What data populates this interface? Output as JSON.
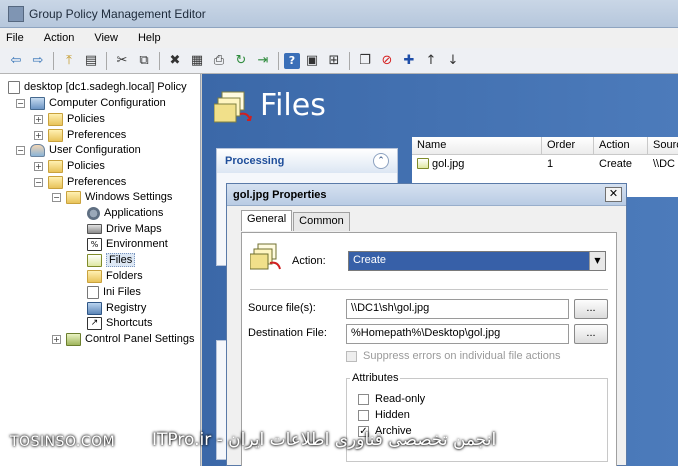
{
  "window": {
    "title": "Group Policy Management Editor"
  },
  "menu": [
    "File",
    "Action",
    "View",
    "Help"
  ],
  "toolbar": {
    "buttons": [
      {
        "name": "back-icon",
        "glyph": "⇦"
      },
      {
        "name": "forward-icon",
        "glyph": "⇨"
      },
      {
        "name": "up-folder-icon",
        "glyph": "⤒"
      },
      {
        "name": "show-hide-tree-icon",
        "glyph": "▤"
      },
      {
        "name": "cut-icon",
        "glyph": "✂"
      },
      {
        "name": "copy-icon",
        "glyph": "⧉"
      },
      {
        "name": "delete-icon",
        "glyph": "✖"
      },
      {
        "name": "properties-icon",
        "glyph": "▦"
      },
      {
        "name": "print-icon",
        "glyph": "⎙"
      },
      {
        "name": "refresh-icon",
        "glyph": "↻"
      },
      {
        "name": "export-icon",
        "glyph": "⇥"
      },
      {
        "name": "help-icon",
        "glyph": "?"
      },
      {
        "name": "view-icon",
        "glyph": "▣"
      },
      {
        "name": "filter-icon",
        "glyph": "⊞"
      },
      {
        "name": "new-item-icon",
        "glyph": "❐"
      },
      {
        "name": "stop-icon",
        "glyph": "⊘"
      },
      {
        "name": "add-icon",
        "glyph": "✚"
      },
      {
        "name": "move-up-icon",
        "glyph": "↑"
      },
      {
        "name": "move-down-icon",
        "glyph": "↓"
      }
    ]
  },
  "tree": {
    "root": "desktop [dc1.sadegh.local] Policy",
    "computer_configuration": "Computer Configuration",
    "cc_policies": "Policies",
    "cc_preferences": "Preferences",
    "user_configuration": "User Configuration",
    "uc_policies": "Policies",
    "uc_preferences": "Preferences",
    "windows_settings": "Windows Settings",
    "applications": "Applications",
    "drive_maps": "Drive Maps",
    "environment": "Environment",
    "files": "Files",
    "folders": "Folders",
    "ini_files": "Ini Files",
    "registry": "Registry",
    "shortcuts": "Shortcuts",
    "control_panel_settings": "Control Panel Settings",
    "selected": "Files"
  },
  "main": {
    "title": "Files",
    "processing_label": "Processing",
    "columns": [
      "Name",
      "Order",
      "Action",
      "Sourc"
    ],
    "rows": [
      {
        "name": "gol.jpg",
        "order": "1",
        "action": "Create",
        "source": "\\\\DC"
      }
    ]
  },
  "dialog": {
    "title": "gol.jpg Properties",
    "tabs": [
      "General",
      "Common"
    ],
    "active_tab": "General",
    "action_label": "Action:",
    "action_value": "Create",
    "source_label": "Source file(s):",
    "source_value": "\\\\DC1\\sh\\gol.jpg",
    "dest_label": "Destination File:",
    "dest_value": "%Homepath%\\Desktop\\gol.jpg",
    "browse_label": "...",
    "suppress_label": "Suppress errors on individual file actions",
    "attributes_label": "Attributes",
    "read_only_label": "Read-only",
    "hidden_label": "Hidden",
    "archive_label": "Archive",
    "read_only_checked": false,
    "hidden_checked": false,
    "archive_checked": true,
    "check_glyph": "✓"
  },
  "watermark": {
    "left": "TOSINSO.COM",
    "right": "ITPro.ir - انجمن تخصصی فناوری اطلاعات ایران"
  }
}
